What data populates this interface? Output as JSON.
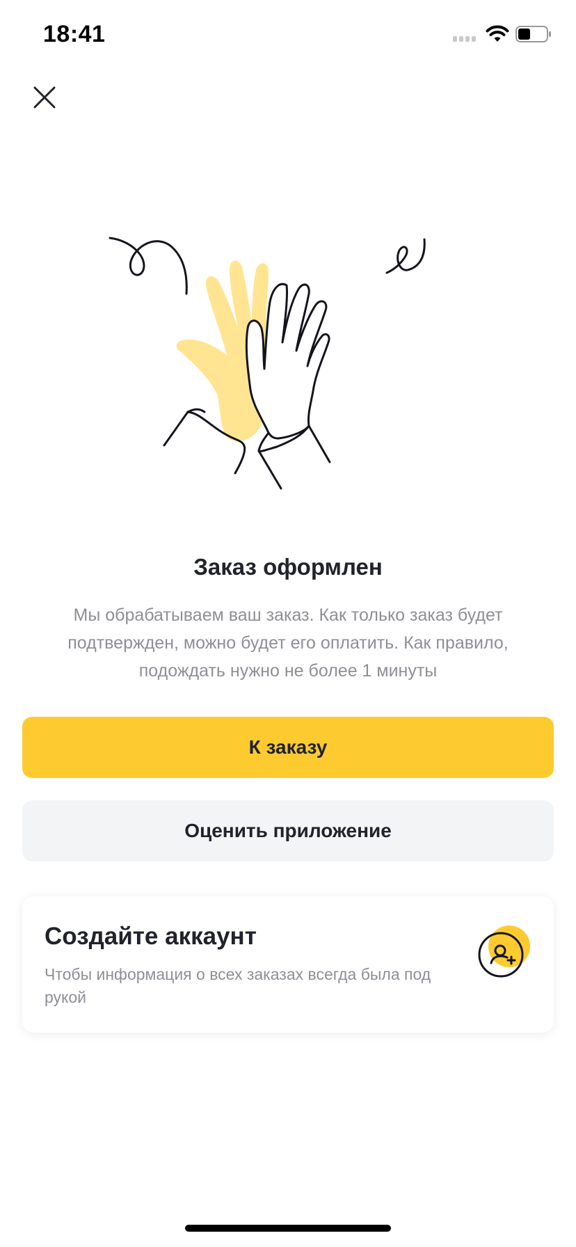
{
  "status_bar": {
    "time": "18:41",
    "icons": [
      "signal-icon",
      "wifi-icon",
      "battery-icon"
    ]
  },
  "header": {
    "close_icon": "close-icon"
  },
  "illustration": {
    "name": "high-five-illustration",
    "colors": {
      "hand_fill": "#ffe592",
      "stroke": "#14151c"
    }
  },
  "main": {
    "title": "Заказ оформлен",
    "description": "Мы обрабатываем ваш заказ. Как только заказ будет подтвержден, можно будет его оплатить. Как правило, подождать нужно не более 1 минуты"
  },
  "buttons": {
    "primary_label": "К заказу",
    "secondary_label": "Оценить приложение"
  },
  "account_card": {
    "title": "Создайте аккаунт",
    "subtitle": "Чтобы информация о всех заказах всегда была под рукой",
    "icon": "add-user-icon"
  },
  "colors": {
    "accent": "#fdcb2f",
    "secondary_bg": "#f3f4f6",
    "text_primary": "#21222b",
    "text_secondary": "#8e8f95"
  }
}
